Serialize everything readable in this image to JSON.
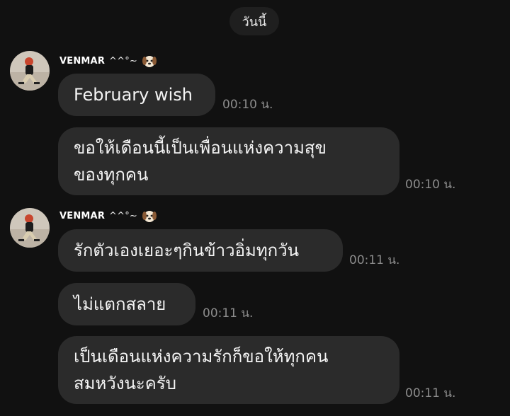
{
  "date_divider": "วันนี้",
  "colors": {
    "background": "#111111",
    "bubble": "#2b2b2b",
    "date_pill": "#1f1f1f",
    "timestamp": "#8c8c8c"
  },
  "groups": [
    {
      "sender": "VENMAR",
      "sender_suffix": "^^°~",
      "sender_icon": "dog-face-icon",
      "messages": [
        {
          "lines": [
            "February wish"
          ],
          "time": "00:10 น."
        },
        {
          "lines": [
            "ขอให้เดือนนี้เป็นเพื่อนแห่งความสุข",
            "ของทุกคน"
          ],
          "time": "00:10 น."
        }
      ]
    },
    {
      "sender": "VENMAR",
      "sender_suffix": "^^°~",
      "sender_icon": "dog-face-icon",
      "messages": [
        {
          "lines": [
            "รักตัวเองเยอะๆกินข้าวอิ่มทุกวัน"
          ],
          "time": "00:11 น."
        },
        {
          "lines": [
            "ไม่แตกสลาย"
          ],
          "time": "00:11 น."
        },
        {
          "lines": [
            "เป็นเดือนแห่งความรักก็ขอให้ทุกคน",
            "สมหวังนะครับ"
          ],
          "time": "00:11 น."
        }
      ]
    }
  ]
}
